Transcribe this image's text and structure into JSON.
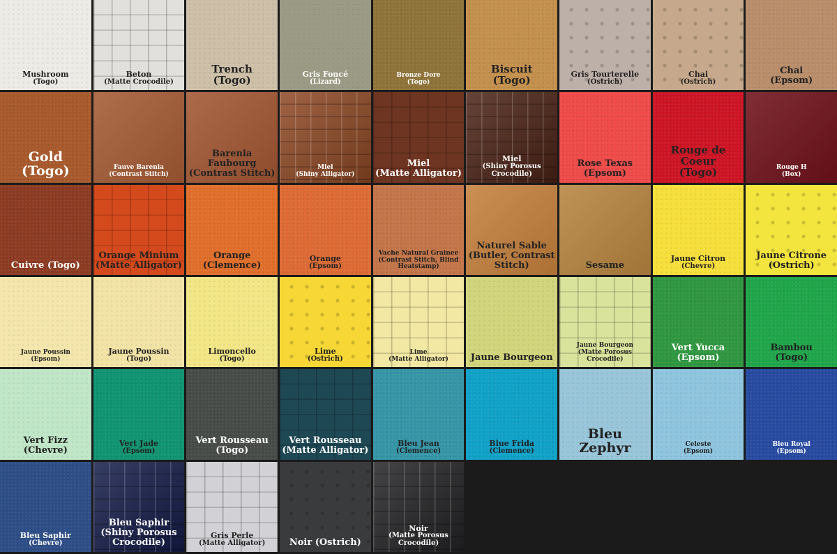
{
  "swatches": [
    {
      "name": "Mushroom",
      "sub": "(Togo)",
      "color": "#ecebe6",
      "text": "#222",
      "size": "s",
      "tex": "pebble"
    },
    {
      "name": "Beton",
      "sub": "(Matte Crocodile)",
      "color": "#e2e0dc",
      "text": "#222",
      "size": "s",
      "tex": "croco"
    },
    {
      "name": "Trench",
      "sub": "(Togo)",
      "color": "#cdbfa7",
      "text": "#222",
      "size": "l",
      "tex": "pebble"
    },
    {
      "name": "Gris Foncé",
      "sub": "(Lizard)",
      "color": "#9b9a84",
      "text": "#fff",
      "size": "s",
      "tex": "lizard"
    },
    {
      "name": "Bronze Dore",
      "sub": "(Togo)",
      "color": "#8e7238",
      "text": "#fff",
      "size": "xs",
      "tex": "pebble"
    },
    {
      "name": "Biscuit",
      "sub": "(Togo)",
      "color": "#c38f4c",
      "text": "#222",
      "size": "l",
      "tex": "pebble"
    },
    {
      "name": "Gris Tourterelle",
      "sub": "(Ostrich)",
      "color": "#bdb0a8",
      "text": "#222",
      "size": "s",
      "tex": "ostrich"
    },
    {
      "name": "Chai",
      "sub": "(Ostrich)",
      "color": "#c6a98c",
      "text": "#222",
      "size": "s",
      "tex": "ostrich"
    },
    {
      "name": "Chai",
      "sub": "(Epsom)",
      "color": "#b98d6a",
      "text": "#222",
      "size": "m",
      "tex": "pebble"
    },
    {
      "name": "Gold",
      "sub": "(Togo)",
      "color": "#a7592b",
      "text": "#fff",
      "size": "xl",
      "tex": "pebble"
    },
    {
      "name": "Fauve Barenia",
      "sub": "(Contrast Stitch)",
      "color": "#a45a33",
      "text": "#fff",
      "size": "xs",
      "tex": "smooth"
    },
    {
      "name": "Barenia Faubourg",
      "sub": "(Contrast Stitch)",
      "color": "#a25632",
      "text": "#222",
      "size": "m",
      "tex": "smooth"
    },
    {
      "name": "Miel",
      "sub": "(Shiny Alligator)",
      "color": "#8e4824",
      "text": "#fff",
      "size": "xs",
      "tex": "shine"
    },
    {
      "name": "Miel",
      "sub": "(Matte Alligator)",
      "color": "#6e3522",
      "text": "#fff",
      "size": "m",
      "tex": "croco"
    },
    {
      "name": "Miel",
      "sub": "(Shiny Porosus Crocodile)",
      "color": "#4b2215",
      "text": "#fff",
      "size": "s",
      "tex": "shine"
    },
    {
      "name": "Rose Texas",
      "sub": "(Epsom)",
      "color": "#ee4a48",
      "text": "#222",
      "size": "m",
      "tex": "pebble"
    },
    {
      "name": "Rouge de Coeur",
      "sub": "(Togo)",
      "color": "#cc1424",
      "text": "#222",
      "size": "l",
      "tex": "pebble"
    },
    {
      "name": "Rouge H",
      "sub": "(Box)",
      "color": "#6f111a",
      "text": "#fff",
      "size": "xs",
      "tex": "smooth"
    },
    {
      "name": "Cuivre (Togo)",
      "sub": "",
      "color": "#8c3b22",
      "text": "#fff",
      "size": "m",
      "tex": "pebble"
    },
    {
      "name": "Orange Minium",
      "sub": "(Matte Alligator)",
      "color": "#d54a1d",
      "text": "#222",
      "size": "m",
      "tex": "croco"
    },
    {
      "name": "Orange",
      "sub": "(Clemence)",
      "color": "#e06e2a",
      "text": "#222",
      "size": "m",
      "tex": "pebble"
    },
    {
      "name": "Orange",
      "sub": "(Epsom)",
      "color": "#dd6a34",
      "text": "#222",
      "size": "s",
      "tex": "pebble"
    },
    {
      "name": "Vache Natural Grainee",
      "sub": "(Contrast Stitch, Blind Heatstamp)",
      "color": "#c37448",
      "text": "#222",
      "size": "xs",
      "tex": "pebble"
    },
    {
      "name": "Naturel Sable",
      "sub": "(Butler, Contrast Stitch)",
      "color": "#c47f3c",
      "text": "#222",
      "size": "m",
      "tex": "smooth"
    },
    {
      "name": "Sesame",
      "sub": "",
      "color": "#b6843f",
      "text": "#222",
      "size": "m",
      "tex": "smooth"
    },
    {
      "name": "Jaune Citron",
      "sub": "(Chevre)",
      "color": "#f6df3a",
      "text": "#222",
      "size": "s",
      "tex": "pebble"
    },
    {
      "name": "Jaune Citrone",
      "sub": "(Ostrich)",
      "color": "#f4e53e",
      "text": "#222",
      "size": "m",
      "tex": "ostrich"
    },
    {
      "name": "Jaune Poussin",
      "sub": "(Epsom)",
      "color": "#f4e6ab",
      "text": "#222",
      "size": "xs",
      "tex": "pebble"
    },
    {
      "name": "Jaune Poussin",
      "sub": "(Togo)",
      "color": "#f2e3a5",
      "text": "#222",
      "size": "s",
      "tex": "pebble"
    },
    {
      "name": "Limoncello",
      "sub": "(Togo)",
      "color": "#f2e685",
      "text": "#222",
      "size": "s",
      "tex": "pebble"
    },
    {
      "name": "Lime",
      "sub": "(Ostrich)",
      "color": "#f6d736",
      "text": "#222",
      "size": "s",
      "tex": "ostrich"
    },
    {
      "name": "Lime",
      "sub": "(Matte Alligator)",
      "color": "#f2e7a3",
      "text": "#222",
      "size": "xs",
      "tex": "croco"
    },
    {
      "name": "Jaune Bourgeon",
      "sub": "",
      "color": "#d1d47a",
      "text": "#222",
      "size": "m",
      "tex": "pebble"
    },
    {
      "name": "Jaune Bourgeon",
      "sub": "(Matte Porosus Crocodile)",
      "color": "#d9e39c",
      "text": "#222",
      "size": "xs",
      "tex": "croco"
    },
    {
      "name": "Vert Yucca",
      "sub": "(Epsom)",
      "color": "#2f9640",
      "text": "#fff",
      "size": "m",
      "tex": "pebble"
    },
    {
      "name": "Bambou",
      "sub": "(Togo)",
      "color": "#1fa54a",
      "text": "#222",
      "size": "m",
      "tex": "pebble"
    },
    {
      "name": "Vert Fizz",
      "sub": "(Chevre)",
      "color": "#bfe6c6",
      "text": "#222",
      "size": "m",
      "tex": "pebble"
    },
    {
      "name": "Vert Jade",
      "sub": "(Epsom)",
      "color": "#0f9370",
      "text": "#222",
      "size": "s",
      "tex": "pebble"
    },
    {
      "name": "Vert Rousseau",
      "sub": "(Togo)",
      "color": "#474b48",
      "text": "#fff",
      "size": "m",
      "tex": "pebble"
    },
    {
      "name": "Vert Rousseau",
      "sub": "(Matte Alligator)",
      "color": "#1f4855",
      "text": "#fff",
      "size": "m",
      "tex": "croco"
    },
    {
      "name": "Bleu Jean",
      "sub": "(Clemence)",
      "color": "#3595a6",
      "text": "#222",
      "size": "s",
      "tex": "pebble"
    },
    {
      "name": "Blue Frida",
      "sub": "(Clemence)",
      "color": "#0fa1c7",
      "text": "#222",
      "size": "s",
      "tex": "pebble"
    },
    {
      "name": "Bleu Zephyr",
      "sub": "",
      "color": "#98c5d9",
      "text": "#222",
      "size": "xl",
      "tex": "pebble"
    },
    {
      "name": "Celeste",
      "sub": "(Epsom)",
      "color": "#8ec4de",
      "text": "#222",
      "size": "xs",
      "tex": "pebble"
    },
    {
      "name": "Bleu Royal",
      "sub": "(Epsom)",
      "color": "#274aa0",
      "text": "#fff",
      "size": "xs",
      "tex": "pebble"
    },
    {
      "name": "Bleu Saphir",
      "sub": "(Chevre)",
      "color": "#2d4d86",
      "text": "#fff",
      "size": "s",
      "tex": "pebble"
    },
    {
      "name": "Bleu Saphir",
      "sub": "(Shiny Porosus Crocodile)",
      "color": "#141c48",
      "text": "#fff",
      "size": "m",
      "tex": "shine"
    },
    {
      "name": "Gris Perle",
      "sub": "(Matte Alligator)",
      "color": "#d1d1d6",
      "text": "#222",
      "size": "s",
      "tex": "croco"
    },
    {
      "name": "Noir (Ostrich)",
      "sub": "",
      "color": "#3a3b3d",
      "text": "#fff",
      "size": "m",
      "tex": "ostrich"
    },
    {
      "name": "Noir",
      "sub": "(Matte Porosus Crocodile)",
      "color": "#232325",
      "text": "#fff",
      "size": "s",
      "tex": "shine"
    }
  ]
}
